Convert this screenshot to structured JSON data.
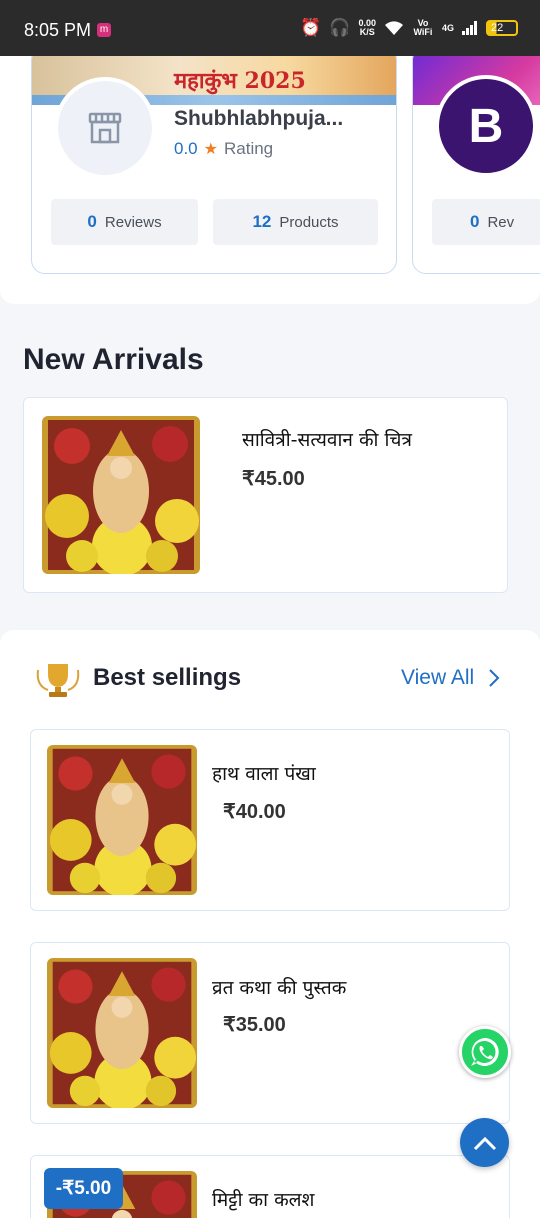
{
  "status_bar": {
    "time": "8:05 PM",
    "app_badge": "m",
    "net_speed": "0.00",
    "net_unit": "K/S",
    "vowifi": "Vo WiFi",
    "signal": "4G",
    "battery": "22"
  },
  "shops": [
    {
      "banner_text": "महाकुंभ 2025",
      "name": "Shubhlabhpuja...",
      "rating_value": "0.0",
      "rating_label": "Rating",
      "reviews_count": "0",
      "reviews_label": "Reviews",
      "products_count": "12",
      "products_label": "Products"
    },
    {
      "avatar_letter": "B",
      "reviews_count": "0",
      "reviews_label": "Rev"
    }
  ],
  "new_arrivals": {
    "title": "New Arrivals",
    "items": [
      {
        "name": "सावित्री-सत्यवान की चित्र",
        "price": "₹45.00"
      }
    ]
  },
  "best_sellings": {
    "title": "Best sellings",
    "view_all": "View All",
    "items": [
      {
        "name": "हाथ वाला पंखा",
        "price": "₹40.00"
      },
      {
        "name": "व्रत कथा की पुस्तक",
        "price": "₹35.00"
      },
      {
        "name": "मिट्टी का कलश",
        "discount": "-₹5.00"
      }
    ]
  },
  "colors": {
    "accent": "#1f6fc4",
    "star": "#f07d1e",
    "whatsapp": "#25d366"
  }
}
